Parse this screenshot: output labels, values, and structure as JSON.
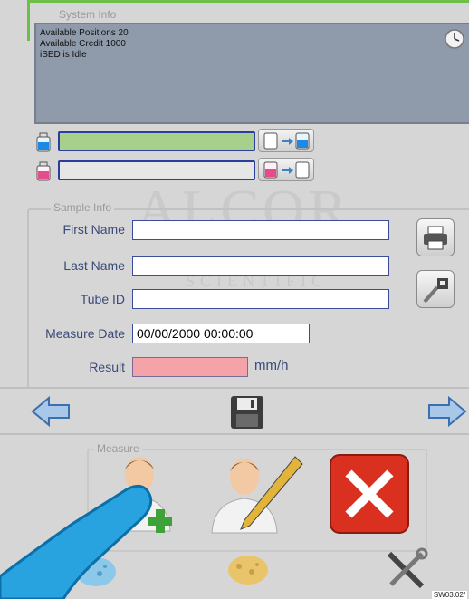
{
  "system_info": {
    "legend": "System Info",
    "lines": [
      "Available Positions 20",
      "Available Credit 1000",
      "iSED is Idle"
    ]
  },
  "reagent_bars": {
    "level_1": 1.0,
    "level_2": 0.0
  },
  "sample_info": {
    "legend": "Sample Info",
    "first_name_label": "First Name",
    "last_name_label": "Last Name",
    "tube_id_label": "Tube ID",
    "measure_date_label": "Measure Date",
    "measure_date_value": "00/00/2000 00:00:00",
    "result_label": "Result",
    "result_unit": "mm/h",
    "first_name_value": "",
    "last_name_value": "",
    "tube_id_value": "",
    "result_value": ""
  },
  "watermark": {
    "main": "ALCOR",
    "sub": "SCIENTIFIC"
  },
  "measure": {
    "legend": "Measure"
  },
  "footer": {
    "code": "SW03.02/"
  },
  "colors": {
    "background": "#d6d6d6",
    "reagent_fill": "#a8d08d",
    "result_fill": "#f4a3a8",
    "field_border": "#3b4c9b",
    "system_box": "#8f9bab"
  }
}
